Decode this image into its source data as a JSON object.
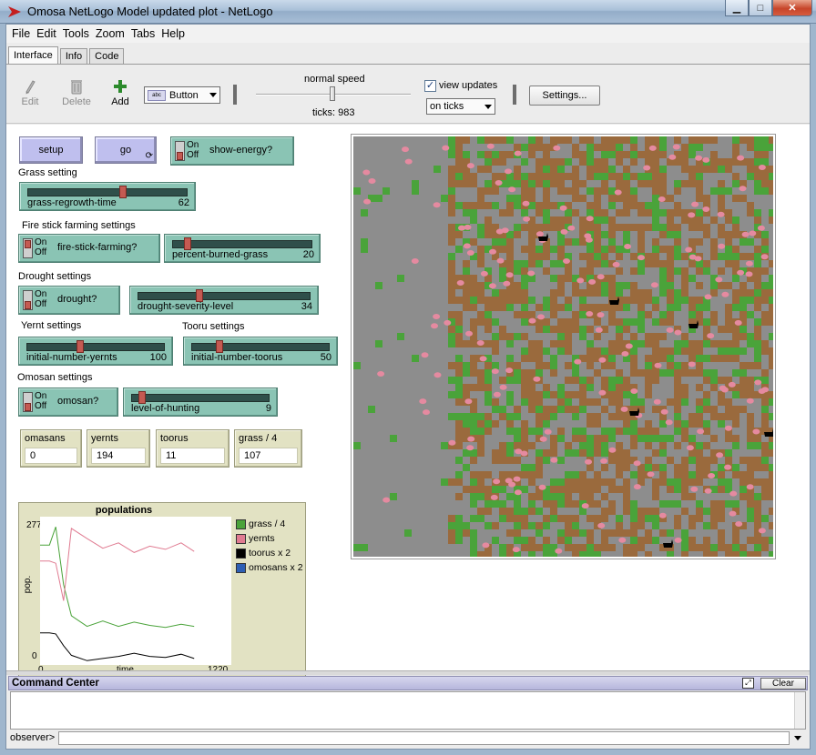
{
  "window": {
    "title": "Omosa NetLogo Model updated plot - NetLogo",
    "minimize": "▁",
    "maximize": "□",
    "close": "✕"
  },
  "menu": [
    "File",
    "Edit",
    "Tools",
    "Zoom",
    "Tabs",
    "Help"
  ],
  "tabs": [
    "Interface",
    "Info",
    "Code"
  ],
  "toolbar": {
    "edit_label": "Edit",
    "delete_label": "Delete",
    "add_label": "Add",
    "widget_type": "Button",
    "widget_type_icon": "abc",
    "speed_label": "normal speed",
    "speed_fraction": 0.5,
    "ticks_label": "ticks: 983",
    "view_updates_label": "view updates",
    "view_updates_checked": "✓",
    "update_mode": "on ticks",
    "settings_label": "Settings..."
  },
  "buttons": {
    "setup": "setup",
    "go": "go",
    "go_forever_icon": "⟳"
  },
  "switches": {
    "on": "On",
    "off": "Off",
    "show_energy": "show-energy?",
    "fire_stick": "fire-stick-farming?",
    "drought": "drought?",
    "omosan": "omosan?"
  },
  "sections": {
    "grass": "Grass setting",
    "fire": "Fire stick farming settings",
    "drought": "Drought settings",
    "yernt": "Yernt settings",
    "tooru": "Tooru settings",
    "omosan": "Omosan settings"
  },
  "sliders": {
    "grass_regrowth": {
      "name": "grass-regrowth-time",
      "value": "62",
      "fraction": 0.6
    },
    "percent_burned": {
      "name": "percent-burned-grass",
      "value": "20",
      "fraction": 0.08
    },
    "drought_severity": {
      "name": "drought-severity-level",
      "value": "34",
      "fraction": 0.35
    },
    "initial_yernts": {
      "name": "initial-number-yernts",
      "value": "100",
      "fraction": 0.38
    },
    "initial_toorus": {
      "name": "initial-number-toorus",
      "value": "50",
      "fraction": 0.18
    },
    "level_hunting": {
      "name": "level-of-hunting",
      "value": "9",
      "fraction": 0.05
    }
  },
  "monitors": [
    {
      "name": "omasans",
      "value": "0"
    },
    {
      "name": "yernts",
      "value": "194"
    },
    {
      "name": "toorus",
      "value": "11"
    },
    {
      "name": "grass / 4",
      "value": "107"
    }
  ],
  "chart_data": {
    "type": "line",
    "title": "populations",
    "xlabel": "time",
    "ylabel": "pop.",
    "xlim": [
      0,
      1220
    ],
    "ylim": [
      0,
      277
    ],
    "x_tick_labels": [
      "0",
      "1220"
    ],
    "y_tick_labels": [
      "0",
      "277"
    ],
    "x": [
      0,
      60,
      100,
      150,
      200,
      300,
      400,
      500,
      600,
      700,
      800,
      900,
      983
    ],
    "series": [
      {
        "name": "grass / 4",
        "color": "#4aa33a",
        "values": [
          224,
          224,
          258,
          150,
          92,
          72,
          82,
          72,
          80,
          74,
          70,
          76,
          72
        ]
      },
      {
        "name": "yernts",
        "color": "#e07b91",
        "values": [
          194,
          194,
          190,
          120,
          255,
          236,
          218,
          228,
          210,
          222,
          216,
          228,
          212
        ]
      },
      {
        "name": "toorus x 2",
        "color": "#000000",
        "values": [
          60,
          60,
          58,
          36,
          18,
          8,
          12,
          16,
          22,
          16,
          14,
          20,
          12
        ]
      },
      {
        "name": "omosans x 2",
        "color": "#2e5fb4",
        "values": []
      }
    ]
  },
  "command_center": {
    "title": "Command Center",
    "clear_label": "Clear",
    "expand_icon": "⤢",
    "prompt": "observer>"
  }
}
